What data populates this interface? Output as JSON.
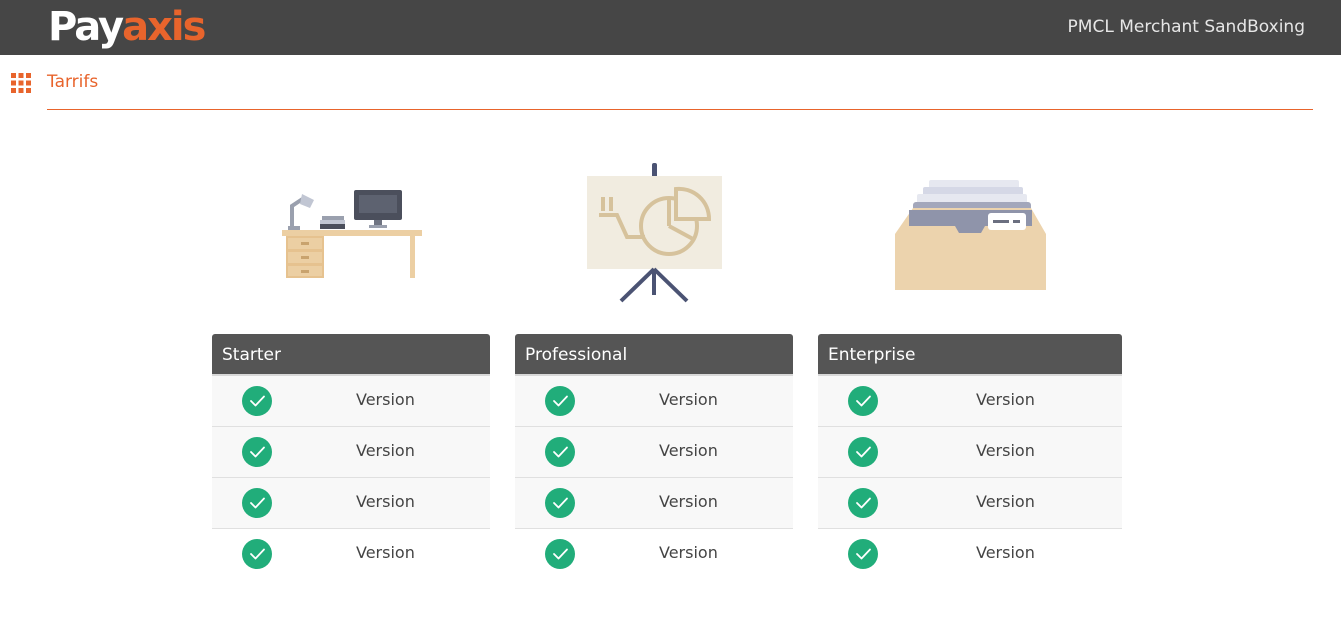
{
  "header": {
    "logo_pay": "Pay",
    "logo_axis": "axis",
    "brand_title": "PMCL Merchant SandBoxing"
  },
  "page": {
    "title": "Tarrifs",
    "menu_icon": "apps-grid-icon"
  },
  "colors": {
    "topbar": "#464646",
    "accent": "#e8642c",
    "plan_header": "#555555",
    "check": "#21ad7a"
  },
  "plans": [
    {
      "name": "Starter",
      "illustration": "desk-icon",
      "features": [
        "Version",
        "Version",
        "Version",
        "Version"
      ]
    },
    {
      "name": "Professional",
      "illustration": "presentation-board-icon",
      "features": [
        "Version",
        "Version",
        "Version",
        "Version"
      ]
    },
    {
      "name": "Enterprise",
      "illustration": "file-drawer-icon",
      "features": [
        "Version",
        "Version",
        "Version",
        "Version"
      ]
    }
  ]
}
